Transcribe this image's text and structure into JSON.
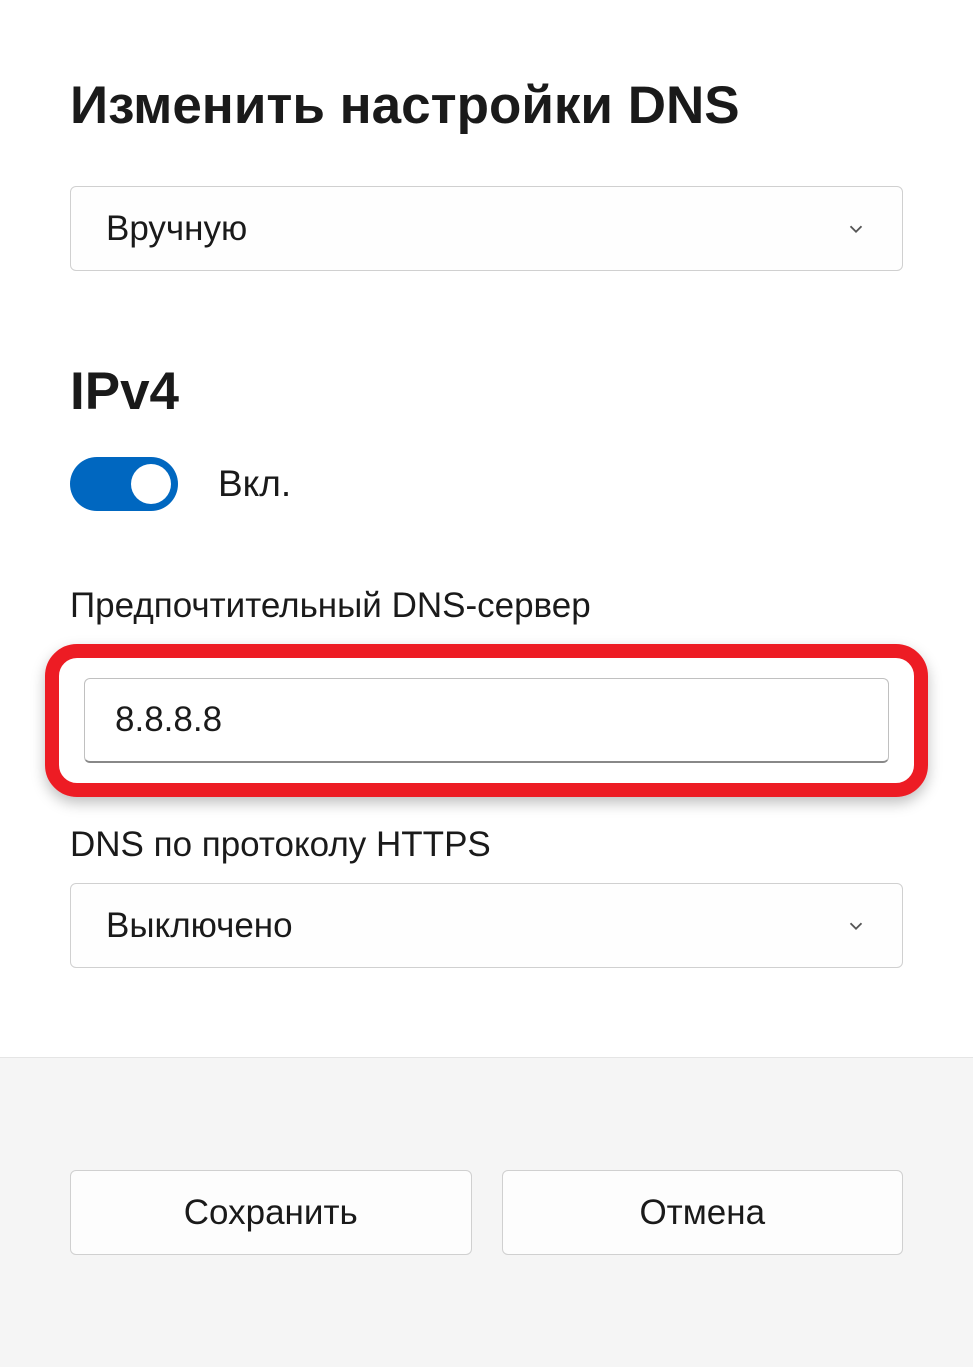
{
  "title": "Изменить настройки DNS",
  "mode_dropdown": {
    "selected": "Вручную"
  },
  "ipv4": {
    "heading": "IPv4",
    "toggle_label": "Вкл."
  },
  "preferred_dns": {
    "label": "Предпочтительный DNS-сервер",
    "value": "8.8.8.8"
  },
  "dns_over_https": {
    "label": "DNS по протоколу HTTPS",
    "selected": "Выключено"
  },
  "buttons": {
    "save": "Сохранить",
    "cancel": "Отмена"
  }
}
